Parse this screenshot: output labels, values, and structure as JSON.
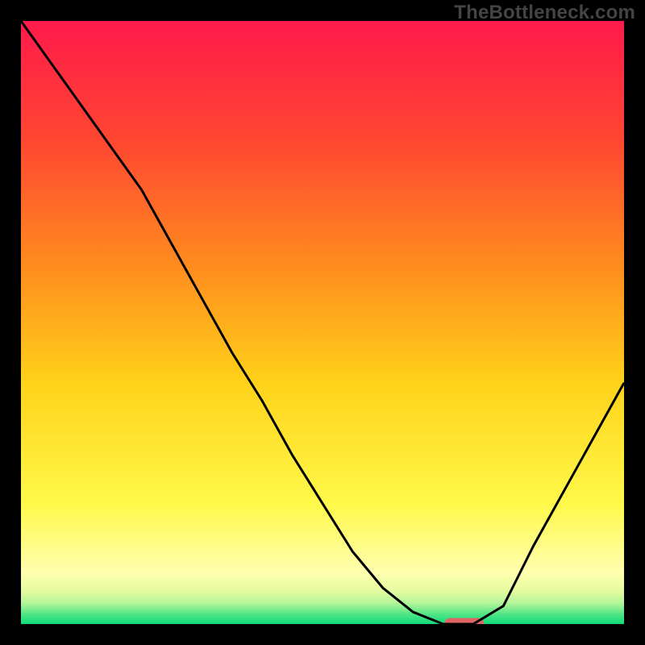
{
  "watermark": "TheBottleneck.com",
  "chart_data": {
    "type": "line",
    "title": "",
    "xlabel": "",
    "ylabel": "",
    "xlim": [
      0,
      100
    ],
    "ylim": [
      0,
      100
    ],
    "grid": false,
    "legend": false,
    "gradient_stops": [
      {
        "offset": 0.0,
        "color": "#ff1a4b"
      },
      {
        "offset": 0.2,
        "color": "#ff4731"
      },
      {
        "offset": 0.4,
        "color": "#ff8a1f"
      },
      {
        "offset": 0.6,
        "color": "#ffd21a"
      },
      {
        "offset": 0.8,
        "color": "#fff94a"
      },
      {
        "offset": 0.915,
        "color": "#ffffb0"
      },
      {
        "offset": 0.945,
        "color": "#e5fca0"
      },
      {
        "offset": 0.965,
        "color": "#b5f59a"
      },
      {
        "offset": 0.985,
        "color": "#4be485"
      },
      {
        "offset": 1.0,
        "color": "#11db7a"
      }
    ],
    "series": [
      {
        "name": "bottleneck-curve",
        "stroke": "#000000",
        "x": [
          0,
          5,
          10,
          15,
          20,
          25,
          30,
          35,
          40,
          45,
          50,
          55,
          60,
          65,
          70,
          72,
          75,
          80,
          82,
          85,
          90,
          95,
          100
        ],
        "y": [
          100,
          93,
          86,
          79,
          72,
          63,
          54,
          45,
          37,
          28,
          20,
          12,
          6,
          2,
          0,
          0,
          0,
          3,
          7,
          13,
          22,
          31,
          40
        ]
      }
    ],
    "marker": {
      "name": "target-marker",
      "color": "#e06666",
      "x_center": 73.5,
      "y_center": 0.2,
      "width": 6.5,
      "height": 1.6,
      "rx": 1.0
    }
  }
}
